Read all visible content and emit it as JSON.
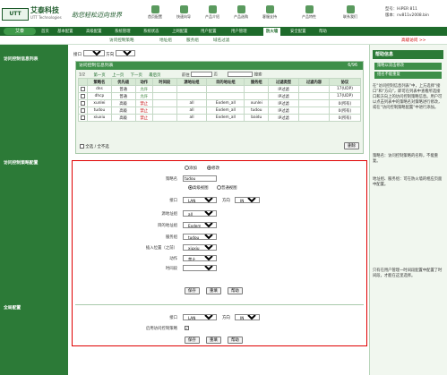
{
  "brand": {
    "logo": "UTT",
    "name": "艾泰科技",
    "sub": "UTT Technologies",
    "slogan": "助您轻松迈向世界"
  },
  "quick_icons": [
    "首页配置",
    "快速向导",
    "产品介绍",
    "产品选购",
    "客服支持",
    "产品特性",
    "联系我们"
  ],
  "device": {
    "model": "型号：HiPER 811",
    "version": "版本：nv811v2008.bin"
  },
  "nav": {
    "logo_btn": "艾泰",
    "tabs": [
      "首页",
      "基本配置",
      "高级配置",
      "系统管理",
      "系统状态",
      "上网配置",
      "用户配置",
      "用户管理",
      "防火墙",
      "安全配置",
      "帮助"
    ],
    "active": "防火墙"
  },
  "subnav": [
    "访问控制策略",
    "地址组",
    "服务组",
    "域名过滤"
  ],
  "subnav_right": "高级访问 >>",
  "left_labels": [
    "访问控制信息列表",
    "访问控制策略配置",
    "全局配置"
  ],
  "list": {
    "iface_label": "接口",
    "iface_value": "LAN",
    "dir_label": "方向",
    "dir_value": "IN",
    "title": "访问控制信息列表",
    "count": "6/96",
    "pager": {
      "page": "1/2",
      "first": "第一页",
      "prev": "上一页",
      "next": "下一页",
      "last": "最后页",
      "goto": "前往",
      "goto_suffix": "页",
      "search": "搜索"
    },
    "headers": [
      "策略名",
      "优先级",
      "动作",
      "时间段",
      "源地址组",
      "目的地址组",
      "服务组",
      "过滤类型",
      "过滤内容",
      "协议"
    ],
    "rows": [
      [
        "dns",
        "普通",
        "允许",
        "",
        "",
        "",
        "",
        "IP过滤",
        "",
        "17(UDP)"
      ],
      [
        "dhcp",
        "普通",
        "允许",
        "",
        "",
        "",
        "",
        "IP过滤",
        "",
        "17(UDP)"
      ],
      [
        "xunlei",
        "高级",
        "禁止",
        "",
        "all",
        "Exdem_all",
        "xunlei",
        "IP过滤",
        "",
        "0(所有)"
      ],
      [
        "tudou",
        "高级",
        "禁止",
        "",
        "all",
        "Exdem_all",
        "tudou",
        "IP过滤",
        "",
        "0(所有)"
      ],
      [
        "xiuxiu",
        "高级",
        "禁止",
        "",
        "all",
        "Exdem_all",
        "baidu",
        "IP过滤",
        "",
        "0(所有)"
      ]
    ],
    "select_all": "全选 / 全不选",
    "delete": "删除"
  },
  "policy": {
    "radio_add": "添加",
    "radio_modify": "修改",
    "name_label": "策略名",
    "name_value": "tudou",
    "view_adv": "高级视图",
    "view_normal": "普通视图",
    "iface_label": "接口",
    "iface_value": "LAN",
    "dir_label": "方向",
    "dir_value": "IN",
    "src_label": "源地址组",
    "src_value": "all",
    "dst_label": "目的地址组",
    "dst_value": "Exdem_all",
    "svc_label": "服务组",
    "svc_value": "tudou",
    "insert_label": "插入位置（之前）",
    "insert_value": "xiuxiu",
    "action_label": "动作",
    "action_value": "禁止",
    "time_label": "时间段",
    "time_value": "",
    "save": "保存",
    "reset": "重填",
    "help": "帮助"
  },
  "global": {
    "iface_label": "接口",
    "iface_value": "LAN",
    "dir_label": "方向",
    "dir_value": "IN",
    "enable_label": "启用访问控制策略",
    "save": "保存",
    "reset": "重填",
    "help": "帮助"
  },
  "help": {
    "title": "帮助信息",
    "tips": [
      "策略以双击修改",
      "组名不能重复"
    ],
    "paragraphs": [
      "在“访问控制信息列表”中，上方选择“接口”和“方向”，即可在列表中查看所选接口和方向上的访问控制策略信息。用户可以点击列表中的策略名对策略进行修改，或在“访问控制策略配置”中进行添加。",
      "策略名：访问控制策略的名称，不能重复。",
      "地址组、服务组：可在防火墙的相应页面中配置。",
      "只有在用户管理一时间段配置中配置了时间段，才能在这里选择。"
    ]
  },
  "colors": {
    "green_dark": "#1e6b2b",
    "green": "#2c7a37",
    "deny": "#c00000",
    "highlight": "#e00000"
  }
}
